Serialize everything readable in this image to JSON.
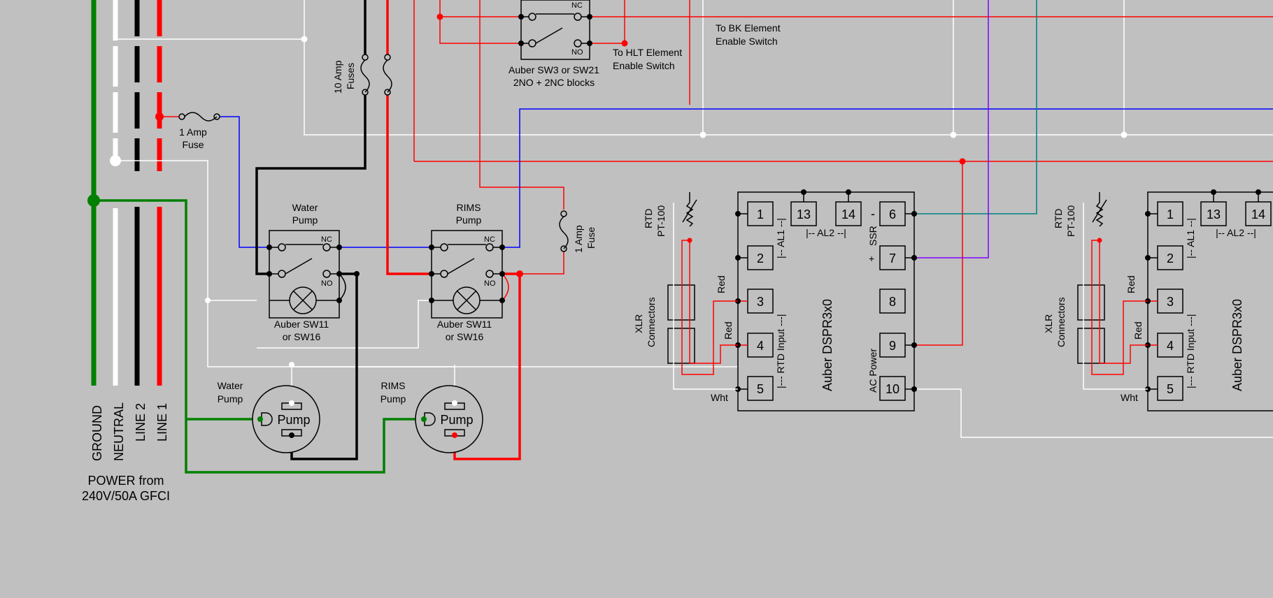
{
  "colors": {
    "background": "#c0c0c0",
    "ground": "#008000",
    "line1": "#ff0000",
    "line2": "#000000",
    "neutral": "#ffffff",
    "control_blue": "#0000ff",
    "ssr_teal": "#008080",
    "ssr_purple": "#8000ff"
  },
  "power": {
    "ground": "GROUND",
    "neutral": "NEUTRAL",
    "line2": "LINE 2",
    "line1": "LINE 1",
    "source_line1": "POWER from",
    "source_line2": "240V/50A GFCI"
  },
  "fuses": {
    "ten_amp_line1": "10 Amp",
    "ten_amp_line2": "Fuses",
    "one_amp_a_line1": "1 Amp",
    "one_amp_a_line2": "Fuse",
    "one_amp_b_line1": "1 Amp",
    "one_amp_b_line2": "Fuse"
  },
  "top_switch": {
    "model_line1": "Auber SW3 or SW21",
    "model_line2": "2NO + 2NC blocks",
    "no": "NO",
    "nc": "NC",
    "hlt_line1": "To HLT Element",
    "hlt_line2": "Enable Switch",
    "bk_line1": "To BK Element",
    "bk_line2": "Enable Switch"
  },
  "switches": [
    {
      "title_line1": "Water",
      "title_line2": "Pump",
      "model_line1": "Auber SW11",
      "model_line2": "or SW16",
      "nc": "NC",
      "no": "NO"
    },
    {
      "title_line1": "RIMS",
      "title_line2": "Pump",
      "model_line1": "Auber SW11",
      "model_line2": "or SW16",
      "nc": "NC",
      "no": "NO"
    }
  ],
  "pumps": [
    {
      "caption_line1": "Water",
      "caption_line2": "Pump",
      "label": "Pump"
    },
    {
      "caption_line1": "RIMS",
      "caption_line2": "Pump",
      "label": "Pump"
    }
  ],
  "controllers": [
    {
      "name": "Auber DSPR3x0",
      "terminals": [
        "1",
        "2",
        "3",
        "4",
        "5",
        "13",
        "14",
        "6",
        "7",
        "8",
        "9",
        "10"
      ],
      "al1": "|-- AL1 --|",
      "al2": "|-- AL2 --|",
      "rtd_input": "|--- RTD Input ---|",
      "ssr": "SSR",
      "ssr_minus": "-",
      "ssr_plus": "+",
      "ac_power": "AC Power",
      "rtd_line1": "RTD",
      "rtd_line2": "PT-100",
      "xlr_line1": "XLR",
      "xlr_line2": "Connectors",
      "red": "Red",
      "wht": "Wht"
    },
    {
      "name": "Auber DSPR3x0",
      "terminals": [
        "1",
        "2",
        "3",
        "4",
        "5",
        "13",
        "14"
      ],
      "al1": "|-- AL1 --|",
      "al2": "|-- AL2 --|",
      "rtd_input": "|--- RTD Input ---|",
      "rtd_line1": "RTD",
      "rtd_line2": "PT-100",
      "xlr_line1": "XLR",
      "xlr_line2": "Connectors",
      "red": "Red",
      "wht": "Wht"
    }
  ]
}
